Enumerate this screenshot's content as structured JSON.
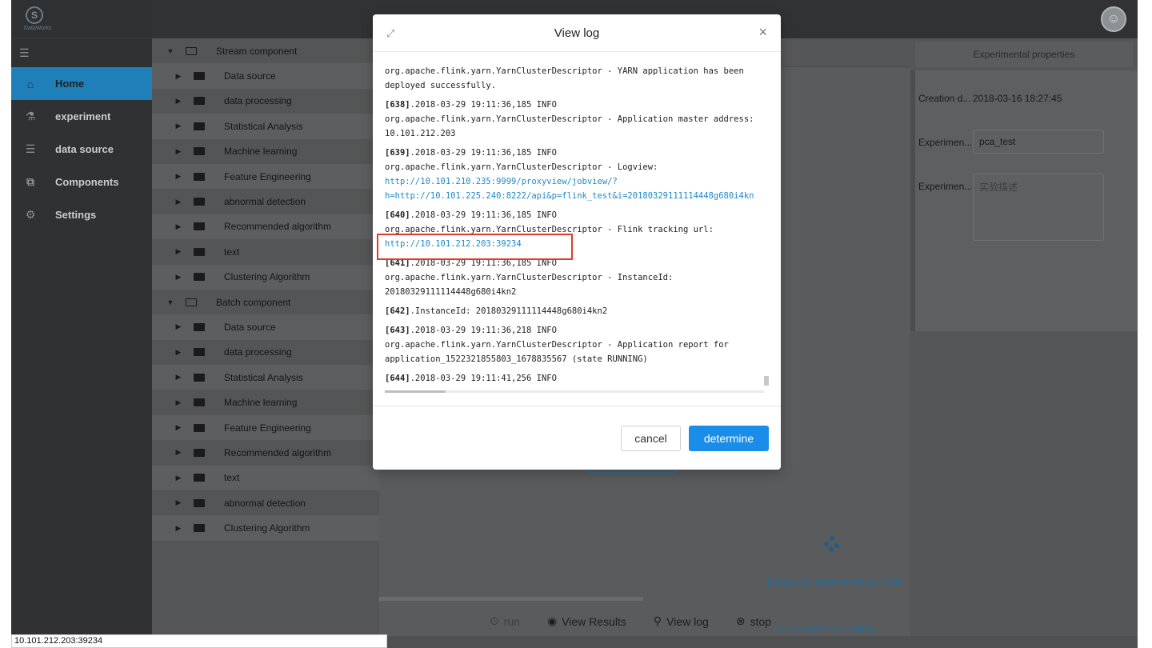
{
  "brand": {
    "name": "DataWorks",
    "logo_glyph": "S"
  },
  "nav": {
    "items": [
      {
        "label": "Home",
        "icon": "home-icon",
        "glyph": "⌂"
      },
      {
        "label": "experiment",
        "icon": "flask-icon",
        "glyph": "⚗"
      },
      {
        "label": "data source",
        "icon": "database-icon",
        "glyph": "☰"
      },
      {
        "label": "Components",
        "icon": "puzzle-icon",
        "glyph": "⧉"
      },
      {
        "label": "Settings",
        "icon": "gear-icon",
        "glyph": "⚙"
      }
    ]
  },
  "tree": {
    "stream": {
      "label": "Stream component",
      "children": [
        "Data source",
        "data processing",
        "Statistical Analysis",
        "Machine learning",
        "Feature Engineering",
        "abnormal detection",
        "Recommended algorithm",
        "text",
        "Clustering Algorithm"
      ]
    },
    "batch": {
      "label": "Batch component",
      "children": [
        "Data source",
        "data processing",
        "Statistical Analysis",
        "Machine learning",
        "Feature Engineering",
        "Recommended algorithm",
        "text",
        "abnormal detection",
        "Clustering Algorithm"
      ]
    }
  },
  "canvas": {
    "hint_line1": "During the experiment run, click",
    "hint_line2": "the View Results button...",
    "toolbar": {
      "run": "run",
      "view_results": "View Results",
      "view_log": "View log",
      "stop": "stop"
    }
  },
  "props": {
    "title": "Experimental properties",
    "creation_label": "Creation d...",
    "creation_value": "2018-03-16 18:27:45",
    "name_label": "Experimen...",
    "name_value": "pca_test",
    "desc_label": "Experimen...",
    "desc_placeholder": "实验描述"
  },
  "modal": {
    "title": "View log",
    "cancel_label": "cancel",
    "ok_label": "determine",
    "log": [
      {
        "idx": "",
        "lines": [
          "org.apache.flink.yarn.YarnClusterDescriptor - YARN application has been",
          "deployed successfully."
        ]
      },
      {
        "idx": "[638]",
        "head": ".2018-03-29 19:11:36,185 INFO",
        "lines": [
          "org.apache.flink.yarn.YarnClusterDescriptor - Application master address:",
          "10.101.212.203"
        ]
      },
      {
        "idx": "[639]",
        "head": ".2018-03-29 19:11:36,185 INFO",
        "lines": [
          "org.apache.flink.yarn.YarnClusterDescriptor - Logview:"
        ],
        "links": [
          "http://10.101.210.235:9999/proxyview/jobview/?",
          "h=http://10.101.225.240:8222/api&p=flink_test&i=20180329111114448g680i4kn"
        ]
      },
      {
        "idx": "[640]",
        "head": ".2018-03-29 19:11:36,185 INFO",
        "lines": [
          "org.apache.flink.yarn.YarnClusterDescriptor - Flink tracking url:"
        ],
        "links": [
          "http://10.101.212.203:39234"
        ]
      },
      {
        "idx": "[641]",
        "head": ".2018-03-29 19:11:36,185 INFO",
        "lines": [
          "org.apache.flink.yarn.YarnClusterDescriptor - InstanceId:",
          "20180329111114448g680i4kn2"
        ]
      },
      {
        "idx": "[642]",
        "head": ".InstanceId: 20180329111114448g680i4kn2",
        "lines": []
      },
      {
        "idx": "[643]",
        "head": ".2018-03-29 19:11:36,218 INFO",
        "lines": [
          "org.apache.flink.yarn.YarnClusterDescriptor - Application report for",
          "application_1522321855803_1678835567 (state RUNNING)"
        ]
      },
      {
        "idx": "[644]",
        "head": ".2018-03-29 19:11:41,256 INFO",
        "lines": []
      }
    ]
  },
  "status_url": "10.101.212.203:39234",
  "colors": {
    "accent": "#1a8de9",
    "highlight": "#e03a2a",
    "link": "#1e88c7",
    "nav_active": "#1f7fb8"
  }
}
